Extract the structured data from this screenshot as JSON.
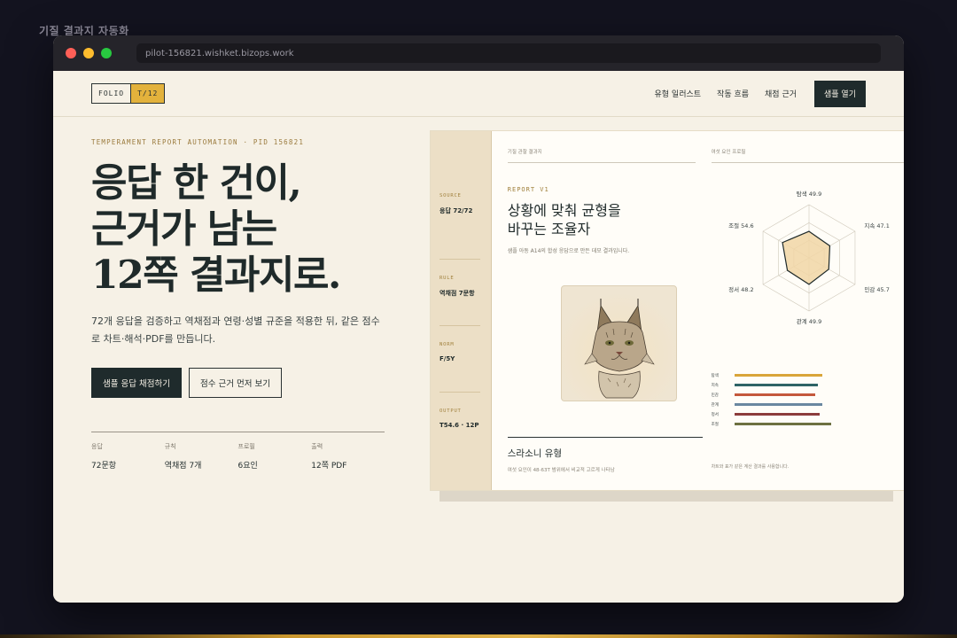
{
  "page_caption": "기질 결과지 자동화",
  "browser": {
    "url": "pilot-156821.wishket.bizops.work"
  },
  "nav": {
    "logo_main": "FOLIO",
    "logo_tag": "T/12",
    "links": [
      "유형 일러스트",
      "작동 흐름",
      "채점 근거"
    ],
    "cta": "샘플 열기"
  },
  "hero": {
    "eyebrow": "TEMPERAMENT REPORT AUTOMATION · PID 156821",
    "title": "응답 한 건이,\n근거가 남는\n12쪽 결과지로.",
    "description": "72개 응답을 검증하고 역채점과 연령·성별 규준을 적용한 뒤, 같은 점수로 차트·해석·PDF를 만듭니다.",
    "primary_button": "샘플 응답 채점하기",
    "secondary_button": "점수 근거 먼저 보기",
    "stats": [
      {
        "label": "응답",
        "value": "72문항"
      },
      {
        "label": "규칙",
        "value": "역채점 7개"
      },
      {
        "label": "프로필",
        "value": "6요인"
      },
      {
        "label": "출력",
        "value": "12쪽 PDF"
      }
    ]
  },
  "report": {
    "side": [
      {
        "label": "SOURCE",
        "value": "응답 72/72"
      },
      {
        "label": "RULE",
        "value": "역채점 7문항"
      },
      {
        "label": "NORM",
        "value": "F/5Y"
      },
      {
        "label": "OUTPUT",
        "value": "T54.6 · 12P"
      }
    ],
    "main_header": "기질 관찰 결과지",
    "eyebrow": "REPORT V1",
    "title": "상황에 맞춰 균형을\n바꾸는 조율자",
    "description": "샘플 아동 A14의 합성 응답으로 만든 데모 결과입니다.",
    "illustration": "lynx",
    "type_name": "스라소니 유형",
    "type_description": "여섯 요인이 48-63T 범위에서 비교적 고르게 나타남",
    "chart_header": "여섯 요인 프로필",
    "chart_note": "차트와 표가 같은 계산 결과를 사용합니다."
  },
  "chart_data": {
    "type": "radar",
    "axes": [
      "탐색",
      "지속",
      "민감",
      "관계",
      "정서",
      "조절"
    ],
    "values": [
      49.9,
      47.1,
      45.7,
      49.9,
      48.2,
      54.6
    ],
    "value_labels": [
      "탐색 49.9",
      "지속 47.1",
      "민감 45.7",
      "관계 49.9",
      "정서 48.2",
      "조절 54.6"
    ],
    "range": [
      20,
      80
    ],
    "fill_color": "#f1d6a6",
    "line_color": "#1f2a2a",
    "bars": [
      {
        "name": "탐색",
        "value": 49.9,
        "color": "#d9a53a"
      },
      {
        "name": "지속",
        "value": 47.1,
        "color": "#2e6466"
      },
      {
        "name": "민감",
        "value": 45.7,
        "color": "#c4583c"
      },
      {
        "name": "관계",
        "value": 49.9,
        "color": "#6a87a0"
      },
      {
        "name": "정서",
        "value": 48.2,
        "color": "#8c3c3c"
      },
      {
        "name": "조절",
        "value": 54.6,
        "color": "#6d7142"
      }
    ]
  }
}
